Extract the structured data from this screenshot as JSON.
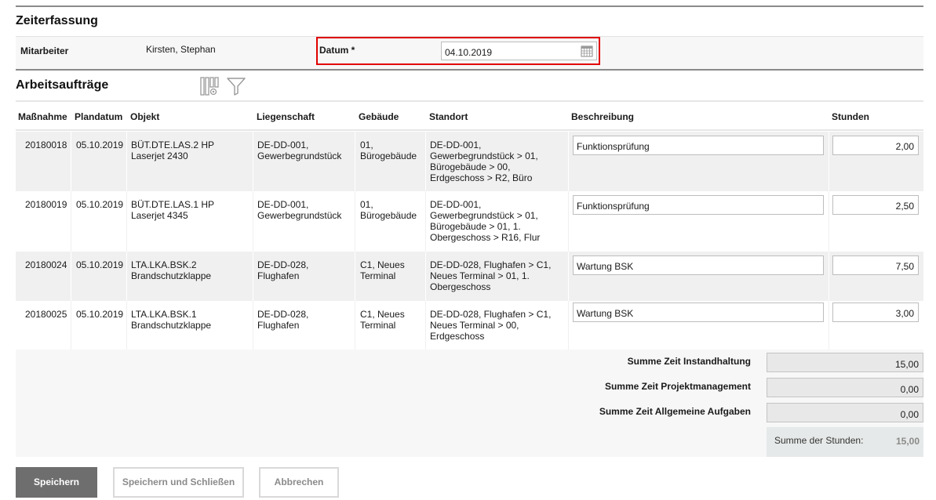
{
  "page": {
    "title": "Zeiterfassung",
    "employee_label": "Mitarbeiter",
    "employee_value": "Kirsten, Stephan",
    "date_label": "Datum *",
    "date_value": "04.10.2019"
  },
  "orders": {
    "title": "Arbeitsaufträge",
    "columns": [
      "Maßnahme",
      "Plandatum",
      "Objekt",
      "Liegenschaft",
      "Gebäude",
      "Standort",
      "Beschreibung",
      "Stunden"
    ],
    "rows": [
      {
        "massnahme": "20180018",
        "plandatum": "05.10.2019",
        "objekt": [
          "BÜT.DTE.LAS.2 HP",
          "Laserjet 2430"
        ],
        "liegenschaft": [
          "DE-DD-001,",
          "Gewerbegrundstück"
        ],
        "gebaeude": [
          "01,",
          "Bürogebäude"
        ],
        "standort": [
          "DE-DD-001,",
          "Gewerbegrundstück > 01,",
          "Bürogebäude > 00,",
          "Erdgeschoss > R2, Büro"
        ],
        "beschreibung": "Funktionsprüfung",
        "stunden": "2,00"
      },
      {
        "massnahme": "20180019",
        "plandatum": "05.10.2019",
        "objekt": [
          "BÜT.DTE.LAS.1 HP",
          "Laserjet 4345"
        ],
        "liegenschaft": [
          "DE-DD-001,",
          "Gewerbegrundstück"
        ],
        "gebaeude": [
          "01,",
          "Bürogebäude"
        ],
        "standort": [
          "DE-DD-001,",
          "Gewerbegrundstück > 01,",
          "Bürogebäude > 01, 1.",
          "Obergeschoss > R16, Flur"
        ],
        "beschreibung": "Funktionsprüfung",
        "stunden": "2,50"
      },
      {
        "massnahme": "20180024",
        "plandatum": "05.10.2019",
        "objekt": [
          "LTA.LKA.BSK.2",
          "Brandschutzklappe"
        ],
        "liegenschaft": [
          "DE-DD-028,",
          "Flughafen"
        ],
        "gebaeude": [
          "C1, Neues",
          "Terminal"
        ],
        "standort": [
          "DE-DD-028, Flughafen > C1,",
          "Neues Terminal > 01, 1.",
          "Obergeschoss"
        ],
        "beschreibung": "Wartung BSK",
        "stunden": "7,50"
      },
      {
        "massnahme": "20180025",
        "plandatum": "05.10.2019",
        "objekt": [
          "LTA.LKA.BSK.1",
          "Brandschutzklappe"
        ],
        "liegenschaft": [
          "DE-DD-028,",
          "Flughafen"
        ],
        "gebaeude": [
          "C1, Neues",
          "Terminal"
        ],
        "standort": [
          "DE-DD-028, Flughafen > C1,",
          "Neues Terminal > 00,",
          "Erdgeschoss"
        ],
        "beschreibung": "Wartung BSK",
        "stunden": "3,00"
      }
    ]
  },
  "sums": {
    "instandhaltung_label": "Summe Zeit Instandhaltung",
    "instandhaltung_value": "15,00",
    "projekt_label": "Summe Zeit Projektmanagement",
    "projekt_value": "0,00",
    "allgemein_label": "Summe Zeit Allgemeine Aufgaben",
    "allgemein_value": "0,00",
    "total_label": "Summe der Stunden:",
    "total_value": "15,00"
  },
  "buttons": {
    "save": "Speichern",
    "save_close": "Speichern und Schließen",
    "cancel": "Abbrechen"
  },
  "icons": {
    "column_settings": "column-settings-icon",
    "filter": "filter-icon",
    "calendar": "calendar-icon"
  },
  "colors": {
    "highlight": "#e00000",
    "primary_button": "#6e6e6e"
  }
}
